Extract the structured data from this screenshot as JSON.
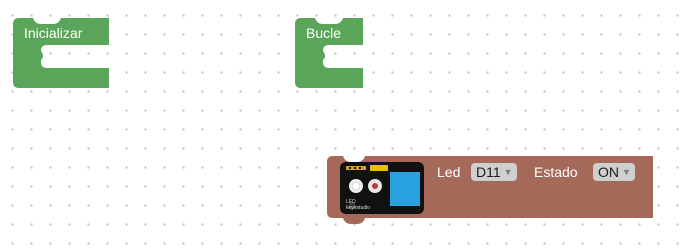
{
  "blocks": {
    "init": {
      "label": "Inicializar",
      "color": "#5ba55b"
    },
    "loop": {
      "label": "Bucle",
      "color": "#5ba55b"
    },
    "led": {
      "color": "#a5695a",
      "label": "Led",
      "pin_value": "D11",
      "state_label": "Estado",
      "state_value": "ON",
      "module": {
        "name": "LED",
        "brand": "keyestudio",
        "led_color": "#29a3e0"
      }
    }
  },
  "icons": {
    "dropdown_arrow": "caret-down-icon"
  }
}
